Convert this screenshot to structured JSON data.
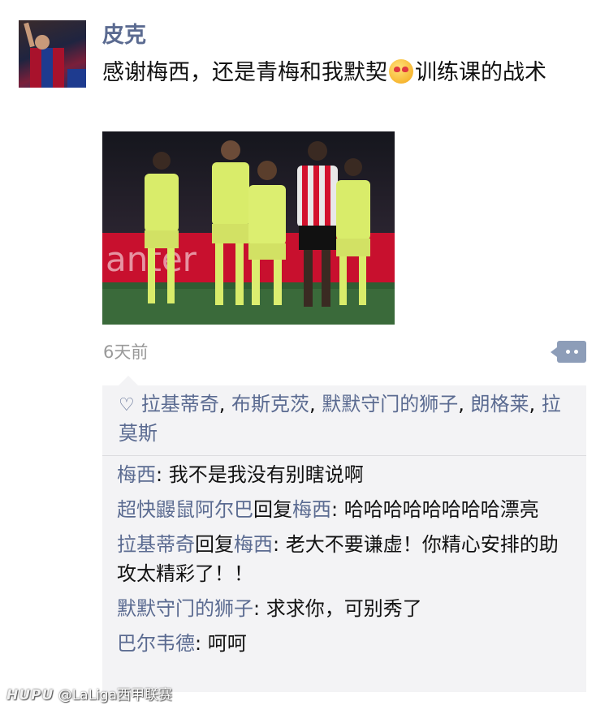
{
  "post": {
    "username": "皮克",
    "text_part1": "感谢梅西，还是青梅和我默契",
    "emoji_icon": "heart-eyes-emoji",
    "text_part2": "训练课的战术",
    "time": "6天前"
  },
  "likes": {
    "names": [
      "拉基蒂奇",
      "布斯克茨",
      "默默守门的狮子",
      "朗格莱",
      "拉莫斯"
    ],
    "separator": ", "
  },
  "comments": [
    {
      "author": "梅西",
      "reply_word": "",
      "reply_to": "",
      "colon": ": ",
      "text": "我不是我没有别瞎说啊"
    },
    {
      "author": "超快鼹鼠阿尔巴",
      "reply_word": "回复",
      "reply_to": "梅西",
      "colon": ": ",
      "text": "哈哈哈哈哈哈哈哈漂亮"
    },
    {
      "author": "拉基蒂奇",
      "reply_word": "回复",
      "reply_to": "梅西",
      "colon": ": ",
      "text": "老大不要谦虚！你精心安排的助攻太精彩了！！"
    },
    {
      "author": "默默守门的狮子",
      "reply_word": "",
      "reply_to": "",
      "colon": ": ",
      "text": "求求你，可别秀了"
    },
    {
      "author": "巴尔韦德",
      "reply_word": "",
      "reply_to": "",
      "colon": ": ",
      "text": "呵呵"
    }
  ],
  "watermark": {
    "brand": "HUPU",
    "account": "@LaLiga西甲联赛"
  },
  "colors": {
    "name_link": "#5b6b91",
    "comment_bg": "#f3f3f5",
    "more_button": "#8d9db8",
    "time_text": "#9a9a9a"
  }
}
